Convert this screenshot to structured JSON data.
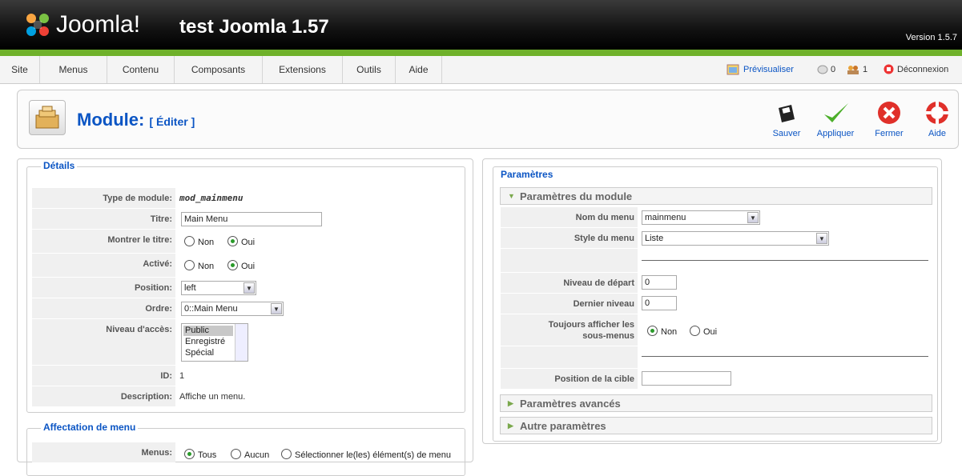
{
  "header": {
    "logo": "Joomla!",
    "site_title": "test Joomla 1.57",
    "version": "Version 1.5.7"
  },
  "menu": [
    "Site",
    "Menus",
    "Contenu",
    "Composants",
    "Extensions",
    "Outils",
    "Aide"
  ],
  "status": {
    "preview": "Prévisualiser",
    "messages_count": "0",
    "users_count": "1",
    "logout": "Déconnexion"
  },
  "toolbar": {
    "title": "Module:",
    "subtitle": "[ Éditer ]",
    "save": "Sauver",
    "apply": "Appliquer",
    "close": "Fermer",
    "help": "Aide"
  },
  "details": {
    "legend": "Détails",
    "type_label": "Type de module:",
    "type_value": "mod_mainmenu",
    "title_label": "Titre:",
    "title_value": "Main Menu",
    "show_title_label": "Montrer le titre:",
    "active_label": "Activé:",
    "no": "Non",
    "yes": "Oui",
    "position_label": "Position:",
    "position_value": "left",
    "order_label": "Ordre:",
    "order_value": "0::Main Menu",
    "access_label": "Niveau d'accès:",
    "access_options": [
      "Public",
      "Enregistré",
      "Spécial"
    ],
    "id_label": "ID:",
    "id_value": "1",
    "desc_label": "Description:",
    "desc_value": "Affiche un menu."
  },
  "menu_assign": {
    "legend": "Affectation de menu",
    "menus_label": "Menus:",
    "all": "Tous",
    "none": "Aucun",
    "select": "Sélectionner le(les) élément(s) de menu"
  },
  "params": {
    "legend": "Paramètres",
    "module_params": "Paramètres du module",
    "menu_name_label": "Nom du menu",
    "menu_name_value": "mainmenu",
    "menu_style_label": "Style du menu",
    "menu_style_value": "Liste",
    "start_level_label": "Niveau de départ",
    "start_level_value": "0",
    "end_level_label": "Dernier niveau",
    "end_level_value": "0",
    "always_show_label_1": "Toujours afficher les",
    "always_show_label_2": "sous-menus",
    "no": "Non",
    "yes": "Oui",
    "target_pos_label": "Position de la cible",
    "target_pos_value": "",
    "advanced": "Paramètres avancés",
    "other": "Autre paramètres"
  },
  "colors": {
    "accent_blue": "#0b55c4",
    "green_bar": "#6fb12b"
  }
}
